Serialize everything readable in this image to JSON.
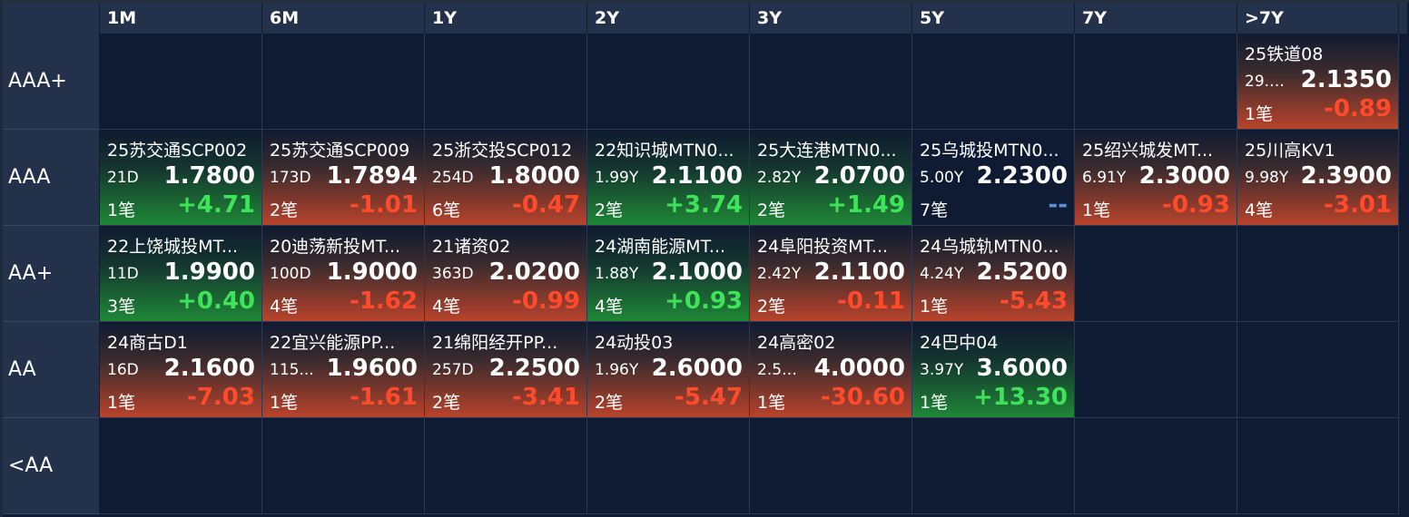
{
  "columns": [
    "1M",
    "6M",
    "1Y",
    "2Y",
    "3Y",
    "5Y",
    "7Y",
    ">7Y"
  ],
  "rows": [
    {
      "label": "AAA+",
      "cells": [
        null,
        null,
        null,
        null,
        null,
        null,
        null,
        {
          "name": "25铁道08",
          "term": "29.9...",
          "yield": "2.1350",
          "count": "1笔",
          "change": "-0.89",
          "trend": "down"
        }
      ]
    },
    {
      "label": "AAA",
      "cells": [
        {
          "name": "25苏交通SCP002",
          "term": "21D",
          "yield": "1.7800",
          "count": "1笔",
          "change": "+4.71",
          "trend": "up"
        },
        {
          "name": "25苏交通SCP009",
          "term": "173D",
          "yield": "1.7894",
          "count": "2笔",
          "change": "-1.01",
          "trend": "down"
        },
        {
          "name": "25浙交投SCP012",
          "term": "254D",
          "yield": "1.8000",
          "count": "6笔",
          "change": "-0.47",
          "trend": "down"
        },
        {
          "name": "22知识城MTN0...",
          "term": "1.99Y",
          "yield": "2.1100",
          "count": "2笔",
          "change": "+3.74",
          "trend": "up"
        },
        {
          "name": "25大连港MTN0...",
          "term": "2.82Y",
          "yield": "2.0700",
          "count": "2笔",
          "change": "+1.49",
          "trend": "up"
        },
        {
          "name": "25乌城投MTN0...",
          "term": "5.00Y",
          "yield": "2.2300",
          "count": "7笔",
          "change": "--",
          "trend": "flat"
        },
        {
          "name": "25绍兴城发MT...",
          "term": "6.91Y",
          "yield": "2.3000",
          "count": "1笔",
          "change": "-0.93",
          "trend": "down"
        },
        {
          "name": "25川高KV1",
          "term": "9.98Y",
          "yield": "2.3900",
          "count": "4笔",
          "change": "-3.01",
          "trend": "down"
        }
      ]
    },
    {
      "label": "AA+",
      "cells": [
        {
          "name": "22上饶城投MT...",
          "term": "11D",
          "yield": "1.9900",
          "count": "3笔",
          "change": "+0.40",
          "trend": "up"
        },
        {
          "name": "20迪荡新投MT...",
          "term": "100D",
          "yield": "1.9000",
          "count": "4笔",
          "change": "-1.62",
          "trend": "down"
        },
        {
          "name": "21诸资02",
          "term": "363D",
          "yield": "2.0200",
          "count": "4笔",
          "change": "-0.99",
          "trend": "down"
        },
        {
          "name": "24湖南能源MT...",
          "term": "1.88Y",
          "yield": "2.1000",
          "count": "4笔",
          "change": "+0.93",
          "trend": "up"
        },
        {
          "name": "24阜阳投资MT...",
          "term": "2.42Y",
          "yield": "2.1100",
          "count": "2笔",
          "change": "-0.11",
          "trend": "down"
        },
        {
          "name": "24乌城轨MTN0...",
          "term": "4.24Y",
          "yield": "2.5200",
          "count": "1笔",
          "change": "-5.43",
          "trend": "down"
        },
        null,
        null
      ]
    },
    {
      "label": "AA",
      "cells": [
        {
          "name": "24商古D1",
          "term": "16D",
          "yield": "2.1600",
          "count": "1笔",
          "change": "-7.03",
          "trend": "down"
        },
        {
          "name": "22宜兴能源PP...",
          "term": "115...",
          "yield": "1.9600",
          "count": "1笔",
          "change": "-1.61",
          "trend": "down"
        },
        {
          "name": "21绵阳经开PP...",
          "term": "257D",
          "yield": "2.2500",
          "count": "2笔",
          "change": "-3.41",
          "trend": "down"
        },
        {
          "name": "24动投03",
          "term": "1.96Y",
          "yield": "2.6000",
          "count": "2笔",
          "change": "-5.47",
          "trend": "down"
        },
        {
          "name": "24高密02",
          "term": "2.58...",
          "yield": "4.0000",
          "count": "1笔",
          "change": "-30.60",
          "trend": "down"
        },
        {
          "name": "24巴中04",
          "term": "3.97Y",
          "yield": "3.6000",
          "count": "1笔",
          "change": "+13.30",
          "trend": "up"
        },
        null,
        null
      ]
    },
    {
      "label": "<AA",
      "cells": [
        null,
        null,
        null,
        null,
        null,
        null,
        null,
        null
      ]
    }
  ]
}
